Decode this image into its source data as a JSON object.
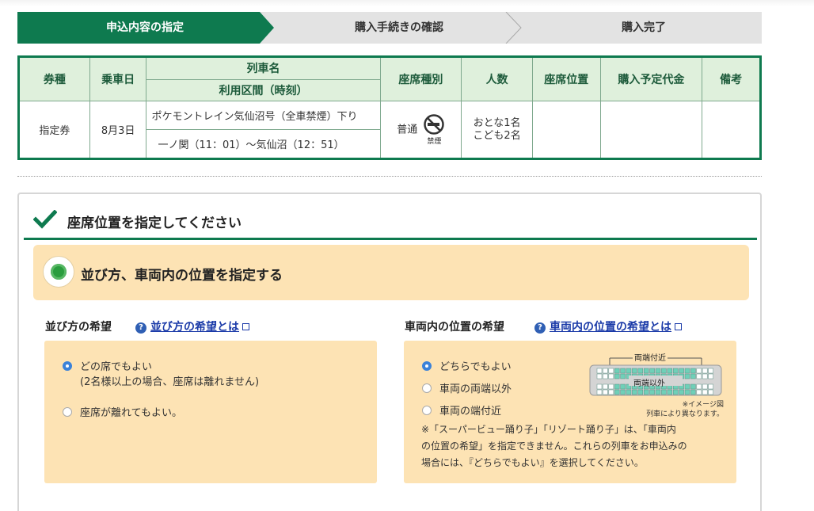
{
  "steps": [
    {
      "label": "申込内容の指定",
      "active": true
    },
    {
      "label": "購入手続きの確認",
      "active": false
    },
    {
      "label": "購入完了",
      "active": false
    }
  ],
  "table": {
    "headers": {
      "ticket_type": "券種",
      "date": "乗車日",
      "train_name": "列車名",
      "section": "利用区間（時刻）",
      "seat_class": "座席種別",
      "people": "人数",
      "seat_position": "座席位置",
      "price": "購入予定代金",
      "remarks": "備考"
    },
    "row": {
      "ticket_type": "指定券",
      "date": "8月3日",
      "train_name": "ポケモントレイン気仙沼号（全車禁煙）下り",
      "section": "一ノ関（11：01）〜気仙沼（12：51）",
      "seat_class": "普通",
      "nosmoke_label": "禁煙",
      "people_line1": "おとな1名",
      "people_line2": "こども2名",
      "seat_position": "",
      "price": "",
      "remarks": ""
    }
  },
  "panel": {
    "title": "座席位置を指定してください",
    "option_label": "並び方、車両内の位置を指定する",
    "arrangement": {
      "heading": "並び方の希望",
      "help_link": "並び方の希望とは",
      "options": [
        {
          "label": "どの席でもよい",
          "selected": true
        },
        {
          "label": "座席が離れてもよい。",
          "selected": false
        }
      ],
      "option1_note": "(2名様以上の場合、座席は離れません)"
    },
    "position": {
      "heading": "車両内の位置の希望",
      "help_link": "車両内の位置の希望とは",
      "options": [
        {
          "label": "どちらでもよい",
          "selected": true
        },
        {
          "label": "車両の両端以外",
          "selected": false
        },
        {
          "label": "車両の端付近",
          "selected": false
        }
      ],
      "diagram_top_label": "両端付近",
      "diagram_mid_label": "両端以外",
      "diagram_caption_1": "※イメージ図",
      "diagram_caption_2": "列車により異なります。",
      "note_1": "※「スーパービュー踊り子」「リゾート踊り子」は、「車両内",
      "note_2": "の位置の希望」を指定できません。これらの列車をお申込みの",
      "note_3": "場合には、『どちらでもよい』を選択してください。"
    }
  },
  "colors": {
    "brand_green": "#0e7a4f",
    "header_green_bg": "#dff0dc",
    "cream": "#fde3b4",
    "link_blue": "#1a3aa8",
    "radio_blue": "#3b82d9"
  }
}
